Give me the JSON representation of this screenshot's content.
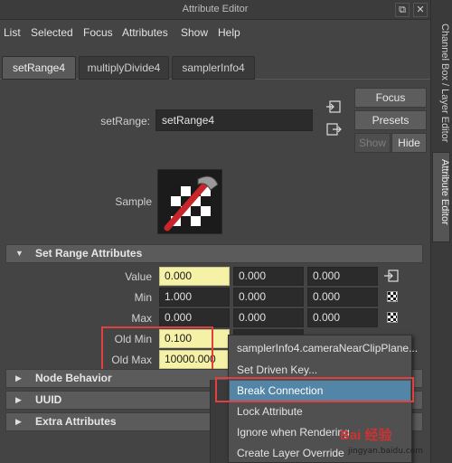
{
  "window": {
    "title": "Attribute Editor"
  },
  "menu": [
    "List",
    "Selected",
    "Focus",
    "Attributes",
    "Show",
    "Help"
  ],
  "tabs": [
    "setRange4",
    "multiplyDivide4",
    "samplerInfo4"
  ],
  "side_tabs": {
    "channel_box": "Channel Box / Layer Editor",
    "attribute_editor": "Attribute Editor"
  },
  "node": {
    "label": "setRange:",
    "value": "setRange4"
  },
  "buttons": {
    "focus": "Focus",
    "presets": "Presets",
    "show": "Show",
    "hide": "Hide"
  },
  "sample_label": "Sample",
  "sections": {
    "set_range": "Set Range Attributes",
    "node_behavior": "Node Behavior",
    "uuid": "UUID",
    "extra": "Extra Attributes"
  },
  "attributes": {
    "value": {
      "label": "Value",
      "v": [
        "0.000",
        "0.000",
        "0.000"
      ]
    },
    "min": {
      "label": "Min",
      "v": [
        "1.000",
        "0.000",
        "0.000"
      ]
    },
    "max": {
      "label": "Max",
      "v": [
        "0.000",
        "0.000",
        "0.000"
      ]
    },
    "old_min": {
      "label": "Old Min",
      "v": [
        "0.100"
      ]
    },
    "old_max": {
      "label": "Old Max",
      "v": [
        "10000.000"
      ]
    }
  },
  "context_menu": [
    "samplerInfo4.cameraNearClipPlane...",
    "Set Driven Key...",
    "Break Connection",
    "Lock Attribute",
    "Ignore when Rendering",
    "Create Layer Override"
  ],
  "watermark": {
    "text": "Bai 经验",
    "sub": "jingyan.baidu.com"
  }
}
